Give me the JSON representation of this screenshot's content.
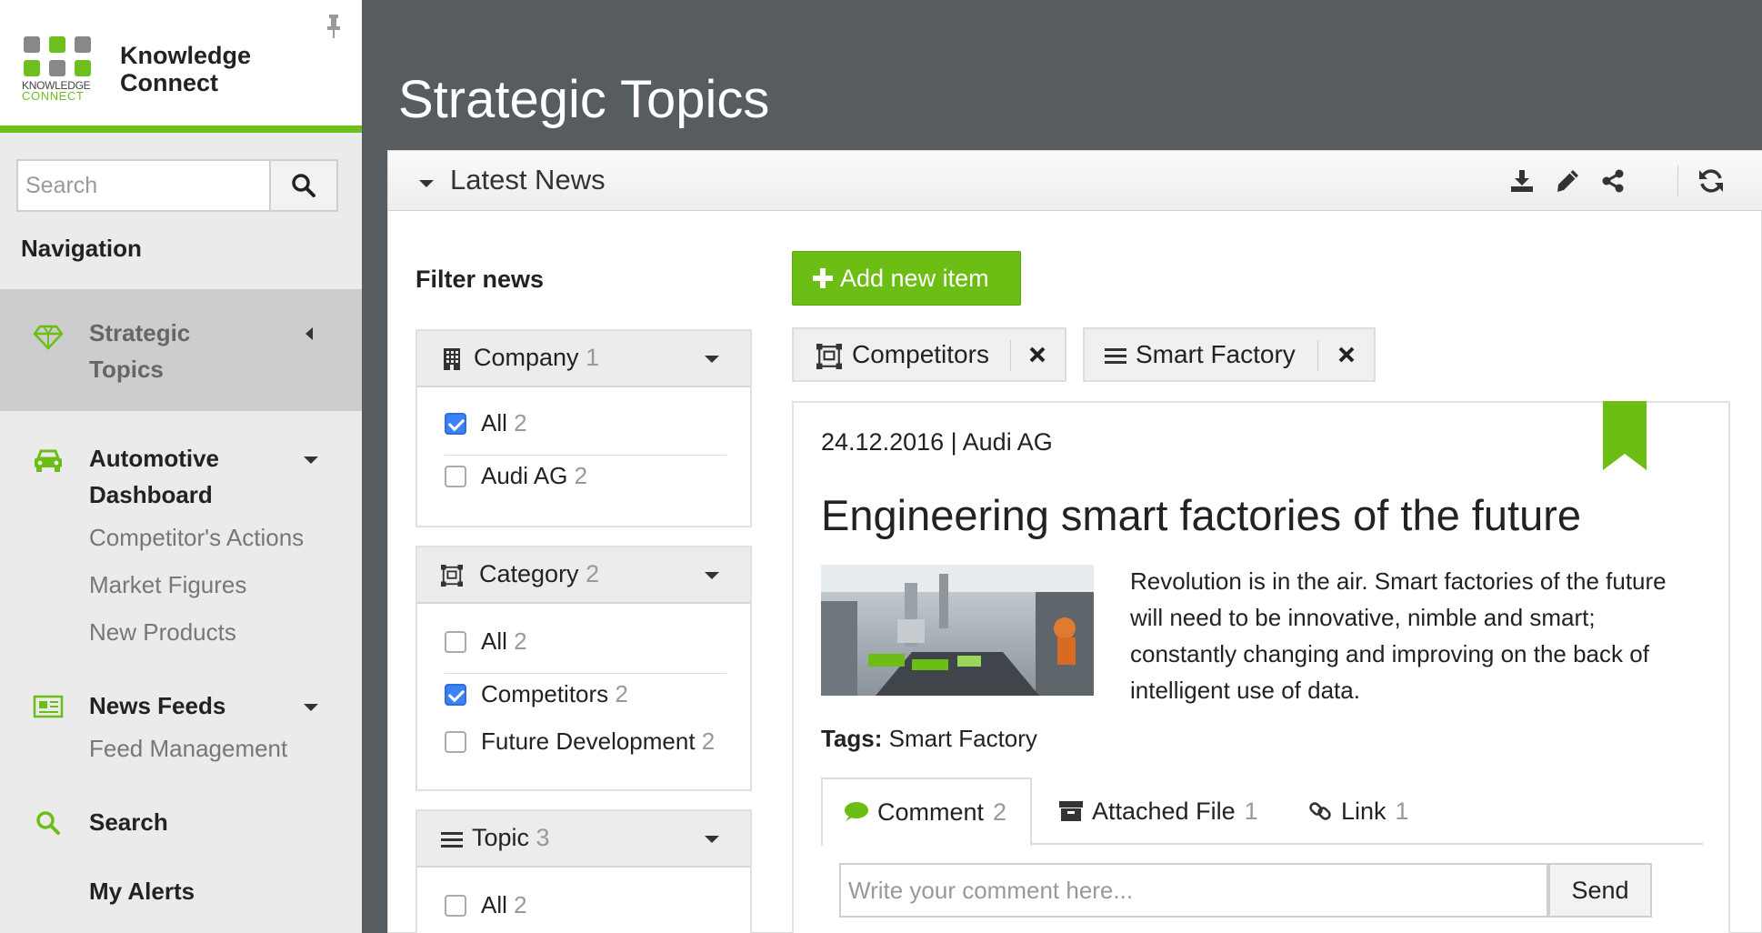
{
  "brand": {
    "name_line1": "Knowledge",
    "name_line2": "Connect",
    "logo_small1": "KNOWLEDGE",
    "logo_small2": "CONNECT"
  },
  "search": {
    "placeholder": "Search"
  },
  "navigation": {
    "title": "Navigation",
    "items": [
      {
        "label_line1": "Strategic",
        "label_line2": "Topics",
        "icon": "diamond-icon",
        "active": true
      },
      {
        "label_line1": "Automotive",
        "label_line2": "Dashboard",
        "icon": "car-icon",
        "children": [
          "Competitor's Actions",
          "Market Figures",
          "New Products"
        ]
      },
      {
        "label_line1": "News Feeds",
        "icon": "newspaper-icon",
        "children": [
          "Feed Management"
        ]
      },
      {
        "label_line1": "Search",
        "icon": "search-icon"
      },
      {
        "label_line1": "My Alerts"
      }
    ]
  },
  "page": {
    "title": "Strategic Topics"
  },
  "panel": {
    "title": "Latest News"
  },
  "filter": {
    "title": "Filter news",
    "facets": [
      {
        "title": "Company",
        "count": "1",
        "options": [
          {
            "label": "All",
            "count": "2",
            "checked": true
          },
          {
            "label": "Audi AG",
            "count": "2",
            "checked": false
          }
        ]
      },
      {
        "title": "Category",
        "count": "2",
        "options": [
          {
            "label": "All",
            "count": "2",
            "checked": false
          },
          {
            "label": "Competitors",
            "count": "2",
            "checked": true
          },
          {
            "label": "Future Development",
            "count": "2",
            "checked": false
          }
        ]
      },
      {
        "title": "Topic",
        "count": "3",
        "options": [
          {
            "label": "All",
            "count": "2",
            "checked": false
          }
        ]
      }
    ]
  },
  "actions": {
    "add_label": "Add new item"
  },
  "active_filters": [
    "Competitors",
    "Smart Factory"
  ],
  "article": {
    "meta": "24.12.2016 | Audi AG",
    "title": "Engineering smart factories of the future",
    "body": "Revolution is in the air. Smart factories of the future will need to be innovative, nimble and smart; constantly changing and improving on the back of intelligent use of data.",
    "tags_label": "Tags:",
    "tags_value": "Smart Factory",
    "tabs": [
      {
        "label": "Comment",
        "count": "2"
      },
      {
        "label": "Attached File",
        "count": "1"
      },
      {
        "label": "Link",
        "count": "1"
      }
    ],
    "comment_placeholder": "Write your comment here...",
    "send_label": "Send"
  },
  "colors": {
    "accent": "#6cbd14",
    "header_bg": "#575c60",
    "checkbox": "#3b82f6"
  }
}
